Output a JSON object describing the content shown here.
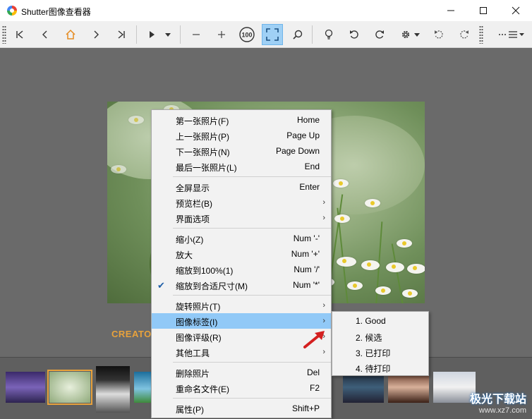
{
  "window": {
    "title": "Shutter图像查看器",
    "controls": [
      "minimize",
      "maximize",
      "close"
    ]
  },
  "toolbar": {
    "buttons": [
      {
        "name": "first-icon"
      },
      {
        "name": "previous-icon"
      },
      {
        "name": "home-icon"
      },
      {
        "name": "next-icon"
      },
      {
        "name": "last-icon"
      },
      {
        "name": "play-icon"
      },
      {
        "name": "dropdown-icon"
      },
      {
        "name": "zoom-out-icon"
      },
      {
        "name": "zoom-in-icon"
      },
      {
        "name": "actual-size-icon",
        "label": "100"
      },
      {
        "name": "fit-screen-icon",
        "active": true
      },
      {
        "name": "search-icon"
      },
      {
        "name": "lightbulb-icon"
      },
      {
        "name": "rotate-left-icon"
      },
      {
        "name": "rotate-right-icon"
      },
      {
        "name": "gear-icon"
      },
      {
        "name": "flip-left-icon"
      },
      {
        "name": "flip-right-icon"
      },
      {
        "name": "menu-icon"
      }
    ],
    "accent_color": "#9fd0f5"
  },
  "viewer": {
    "caption": "CREATO"
  },
  "context_menu": {
    "groups": [
      [
        {
          "label": "第一张照片(F)",
          "accel": "Home"
        },
        {
          "label": "上一张照片(P)",
          "accel": "Page Up"
        },
        {
          "label": "下一张照片(N)",
          "accel": "Page Down"
        },
        {
          "label": "最后一张照片(L)",
          "accel": "End"
        }
      ],
      [
        {
          "label": "全屏显示",
          "accel": "Enter"
        },
        {
          "label": "预览栏(B)",
          "submenu": true
        },
        {
          "label": "界面选项",
          "submenu": true
        }
      ],
      [
        {
          "label": "缩小(Z)",
          "accel": "Num '-'"
        },
        {
          "label": "放大",
          "accel": "Num '+'"
        },
        {
          "label": "缩放到100%(1)",
          "accel": "Num '/'"
        },
        {
          "label": "缩放到合适尺寸(M)",
          "accel": "Num '*'",
          "checked": true
        }
      ],
      [
        {
          "label": "旋转照片(T)",
          "submenu": true
        },
        {
          "label": "图像标签(I)",
          "submenu": true,
          "highlighted": true
        },
        {
          "label": "图像评级(R)",
          "submenu": true
        },
        {
          "label": "其他工具",
          "submenu": true
        }
      ],
      [
        {
          "label": "删除照片",
          "accel": "Del"
        },
        {
          "label": "重命名文件(E)",
          "accel": "F2"
        }
      ],
      [
        {
          "label": "属性(P)",
          "accel": "Shift+P"
        }
      ]
    ],
    "highlight_color": "#91c9f7"
  },
  "submenu": {
    "items": [
      "1. Good",
      "2. 候选",
      "3. 已打印",
      "4. 待打印"
    ]
  },
  "thumbnails": {
    "count": 9,
    "selected_index": 1,
    "selected_color": "#e8a23c"
  },
  "watermark": {
    "main": "极光下载站",
    "url": "www.xz7.com"
  }
}
